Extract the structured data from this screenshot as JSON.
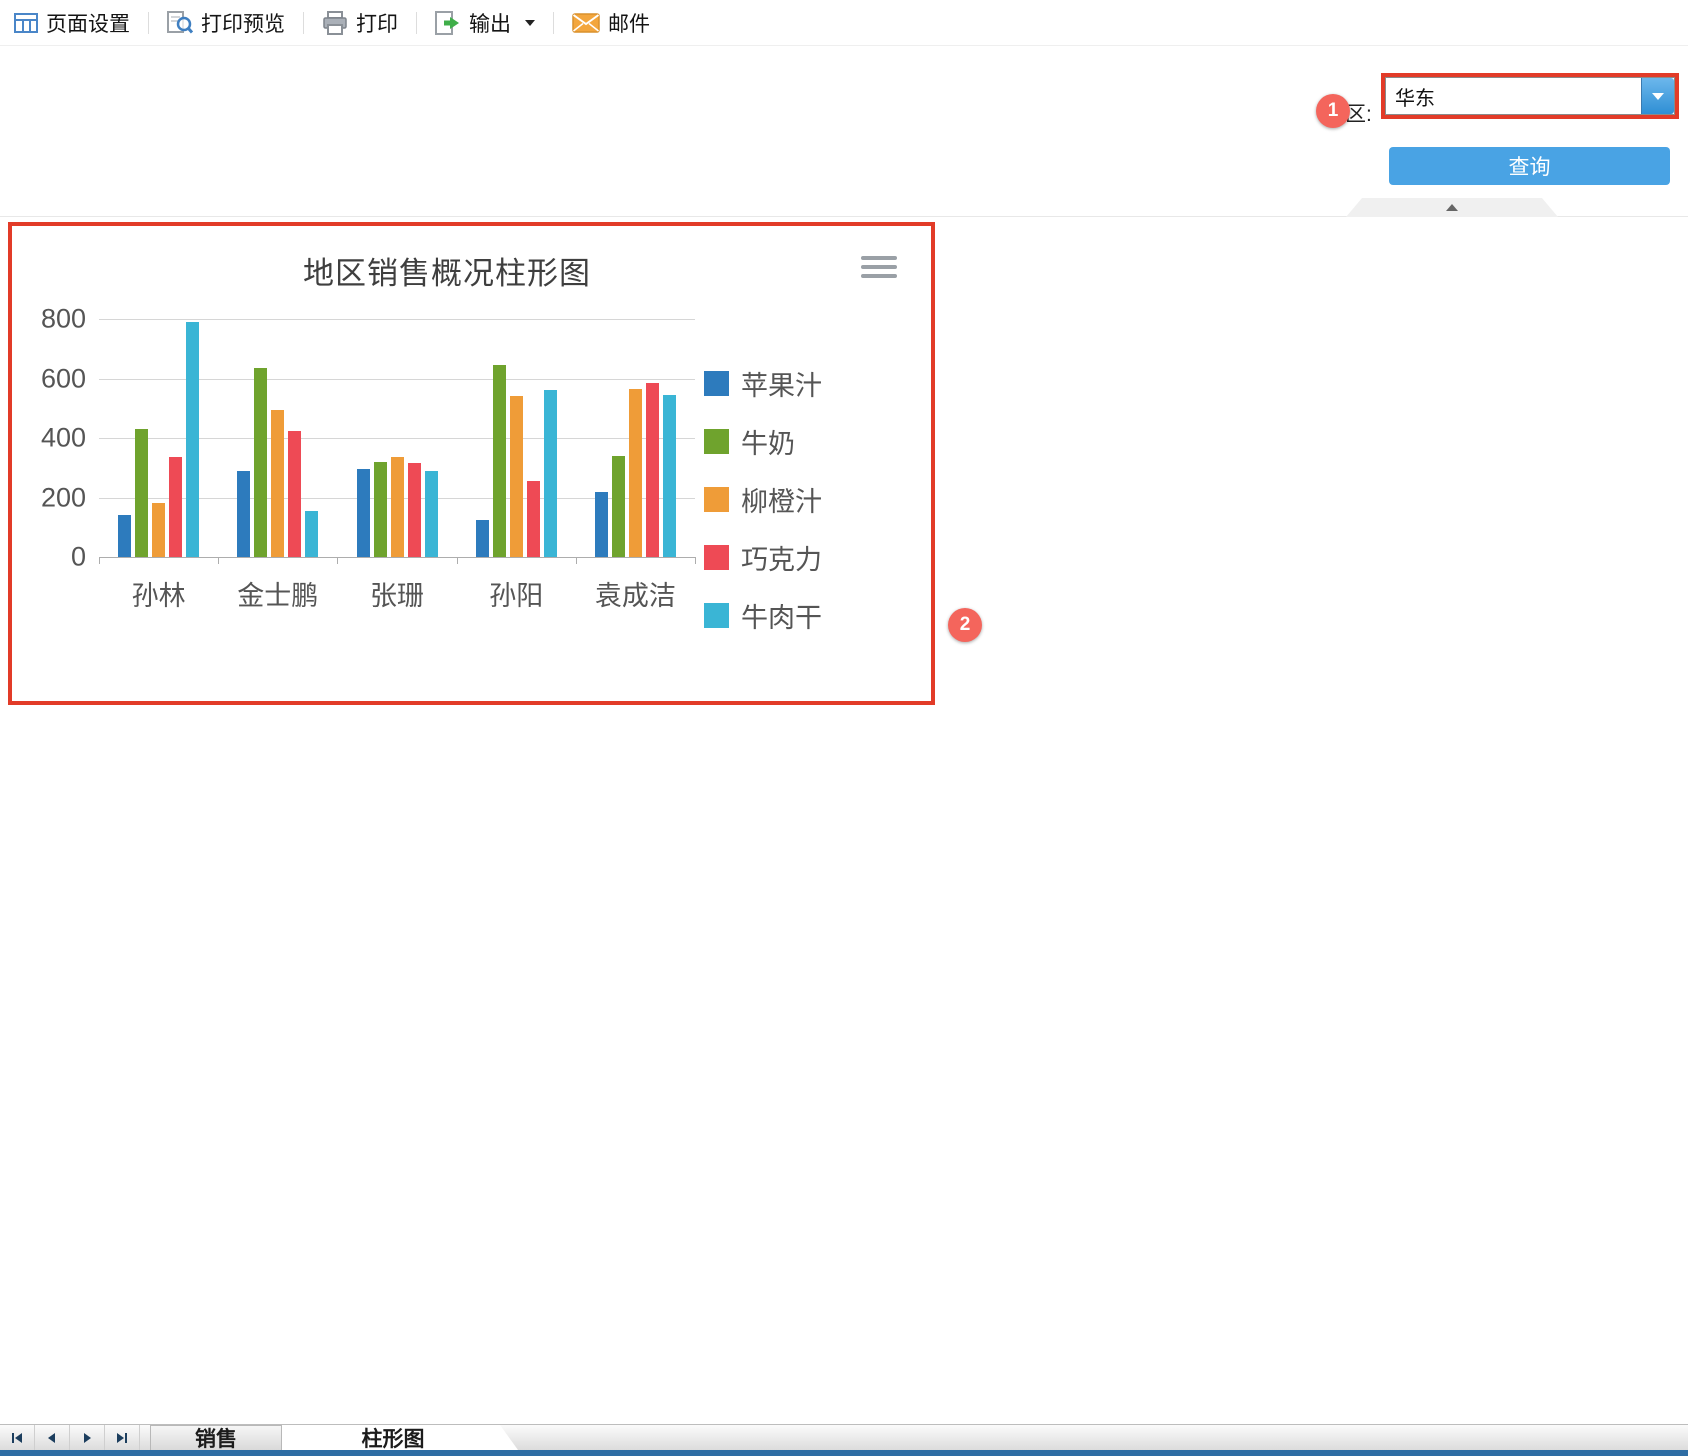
{
  "toolbar": {
    "items": [
      {
        "label": "页面设置",
        "icon": "page-setup-icon"
      },
      {
        "label": "打印预览",
        "icon": "print-preview-icon"
      },
      {
        "label": "打印",
        "icon": "print-icon"
      },
      {
        "label": "输出",
        "icon": "export-icon",
        "has_dropdown": true
      },
      {
        "label": "邮件",
        "icon": "mail-icon"
      }
    ]
  },
  "param_panel": {
    "region_label": "地区:",
    "region_value": "华东",
    "query_label": "查询"
  },
  "annotations": {
    "badges": [
      "1",
      "2"
    ],
    "highlight_color": "#e23b28"
  },
  "chart_data": {
    "type": "bar",
    "title": "地区销售概况柱形图",
    "categories": [
      "孙林",
      "金士鹏",
      "张珊",
      "孙阳",
      "袁成洁"
    ],
    "series": [
      {
        "name": "苹果汁",
        "color": "#2d7bbd",
        "values": [
          140,
          290,
          295,
          125,
          220
        ]
      },
      {
        "name": "牛奶",
        "color": "#6fa32d",
        "values": [
          430,
          635,
          320,
          645,
          340
        ]
      },
      {
        "name": "柳橙汁",
        "color": "#ef9c38",
        "values": [
          180,
          495,
          335,
          540,
          565
        ]
      },
      {
        "name": "巧克力",
        "color": "#ee4a55",
        "values": [
          335,
          425,
          315,
          255,
          585
        ]
      },
      {
        "name": "牛肉干",
        "color": "#3ab5d5",
        "values": [
          790,
          155,
          290,
          560,
          545
        ]
      }
    ],
    "ylim": [
      0,
      800
    ],
    "yticks": [
      0,
      200,
      400,
      600,
      800
    ],
    "grid": true,
    "legend_position": "right"
  },
  "sheet_bar": {
    "tabs": [
      {
        "label": "销售",
        "active": false
      },
      {
        "label": "柱形图",
        "active": true
      }
    ]
  }
}
